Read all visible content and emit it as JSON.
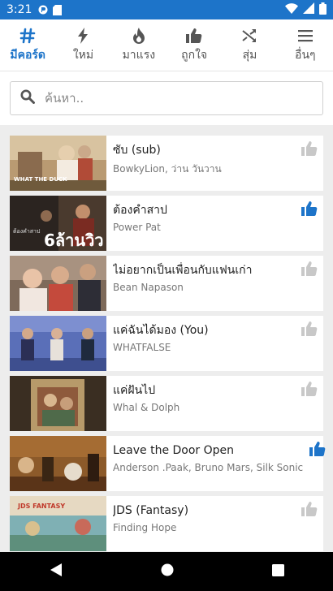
{
  "status": {
    "time": "3:21"
  },
  "colors": {
    "accent": "#1d74c9",
    "like_active": "#1d74c9",
    "like_inactive": "#c8c8c8"
  },
  "tabs": [
    {
      "label": "มีคอร์ด",
      "icon": "hash-icon",
      "active": true
    },
    {
      "label": "ใหม่",
      "icon": "bolt-icon",
      "active": false
    },
    {
      "label": "มาแรง",
      "icon": "fire-icon",
      "active": false
    },
    {
      "label": "ถูกใจ",
      "icon": "thumbs-up-icon",
      "active": false
    },
    {
      "label": "สุ่ม",
      "icon": "shuffle-icon",
      "active": false
    },
    {
      "label": "อื่นๆ",
      "icon": "menu-icon",
      "active": false
    }
  ],
  "search": {
    "placeholder": "ค้นหา.."
  },
  "songs": [
    {
      "title": "ซับ (sub)",
      "artist": "BowkyLion, ว่าน วันวาน",
      "liked": false
    },
    {
      "title": "ต้องคำสาป",
      "artist": "Power Pat",
      "liked": true
    },
    {
      "title": "ไม่อยากเป็นเพื่อนกับแฟนเก่า",
      "artist": "Bean Napason",
      "liked": false
    },
    {
      "title": "แค่ฉันได้มอง (You)",
      "artist": "WHATFALSE",
      "liked": false
    },
    {
      "title": "แค่ฝันไป",
      "artist": "Whal & Dolph",
      "liked": false
    },
    {
      "title": "Leave the Door Open",
      "artist": "Anderson .Paak, Bruno Mars, Silk Sonic",
      "liked": true
    },
    {
      "title": "JDS (Fantasy)",
      "artist": "Finding Hope",
      "liked": false
    }
  ],
  "thumb_text": {
    "t1": "WHAT THE DUCK",
    "t2": "6ล้านวิว",
    "t2b": "ต้องคำสาป",
    "t7": "JDS FANTASY"
  }
}
